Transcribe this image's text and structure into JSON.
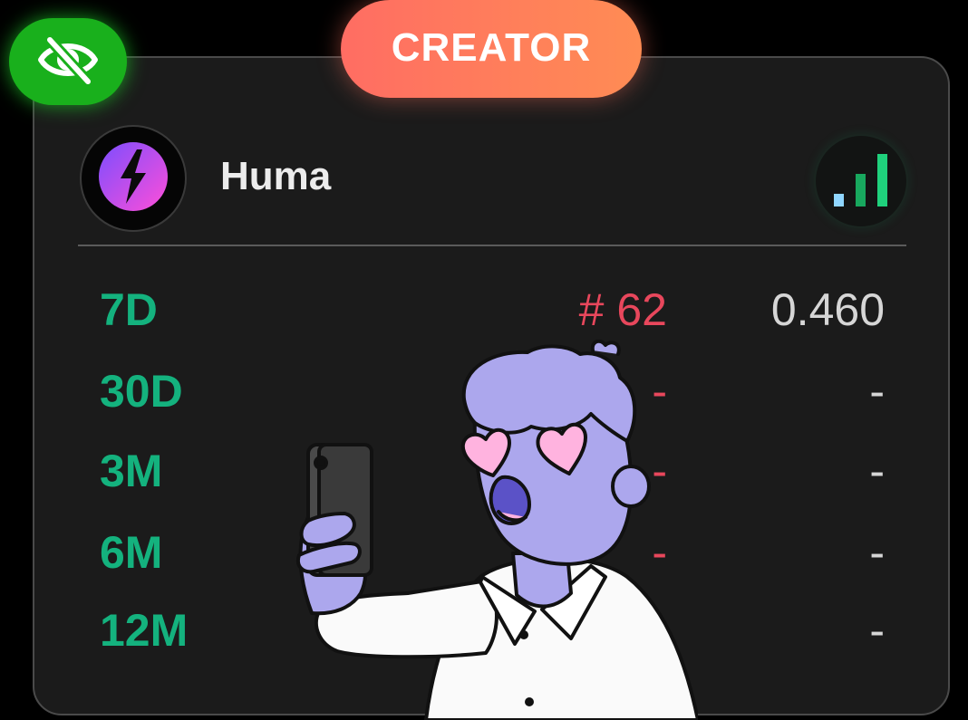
{
  "badge": {
    "label": "CREATOR",
    "gradient_start": "#ff6d63",
    "gradient_end": "#ff8c54"
  },
  "visibility_toggle": {
    "icon": "eye-off-icon",
    "color": "#19b01c"
  },
  "profile": {
    "name": "Huma",
    "avatar_icon": "lightning-bolt-logo",
    "avatar_gradient": [
      "#7b4dff",
      "#ff4fd8"
    ],
    "signal_icon": "signal-bars-icon",
    "signal_color": "#18c27e"
  },
  "stats": [
    {
      "period": "7D",
      "rank": "# 62",
      "score": "0.460"
    },
    {
      "period": "30D",
      "rank": "-",
      "score": "-"
    },
    {
      "period": "3M",
      "rank": "-",
      "score": "-"
    },
    {
      "period": "6M",
      "rank": "-",
      "score": "-"
    },
    {
      "period": "12M",
      "rank": "-",
      "score": "-"
    }
  ],
  "colors": {
    "period": "#14b27e",
    "rank": "#e8475c",
    "score": "#d6d6d6",
    "card_background": "#1b1b1b"
  },
  "overlay_illustration": "person-taking-selfie-heart-eyes"
}
